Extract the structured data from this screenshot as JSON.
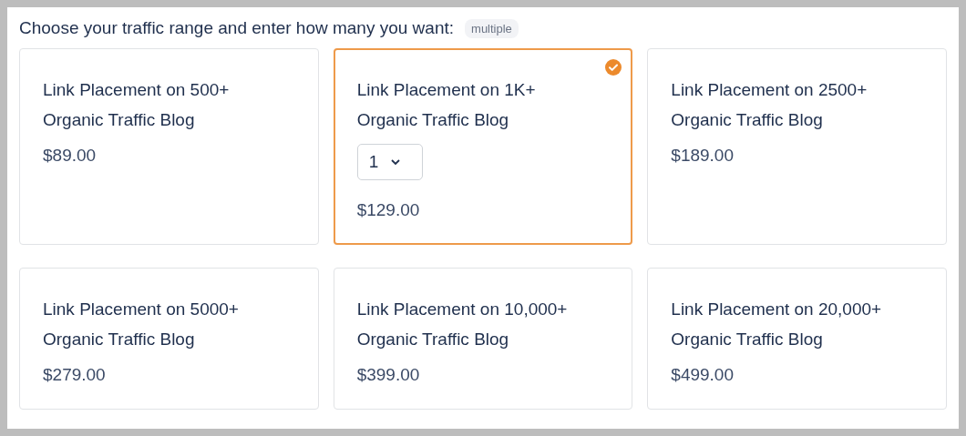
{
  "heading": "Choose your traffic range and enter how many you want:",
  "badge": "multiple",
  "options": [
    {
      "title": "Link Placement on 500+ Organic Traffic Blog",
      "price": "$89.00",
      "selected": false
    },
    {
      "title": "Link Placement on 1K+ Organic Traffic Blog",
      "price": "$129.00",
      "selected": true,
      "quantity": "1"
    },
    {
      "title": "Link Placement on 2500+ Organic Traffic Blog",
      "price": "$189.00",
      "selected": false
    },
    {
      "title": "Link Placement on 5000+ Organic Traffic Blog",
      "price": "$279.00",
      "selected": false
    },
    {
      "title": "Link Placement on 10,000+ Organic Traffic Blog",
      "price": "$399.00",
      "selected": false
    },
    {
      "title": "Link Placement on 20,000+ Organic Traffic Blog",
      "price": "$499.00",
      "selected": false
    }
  ]
}
